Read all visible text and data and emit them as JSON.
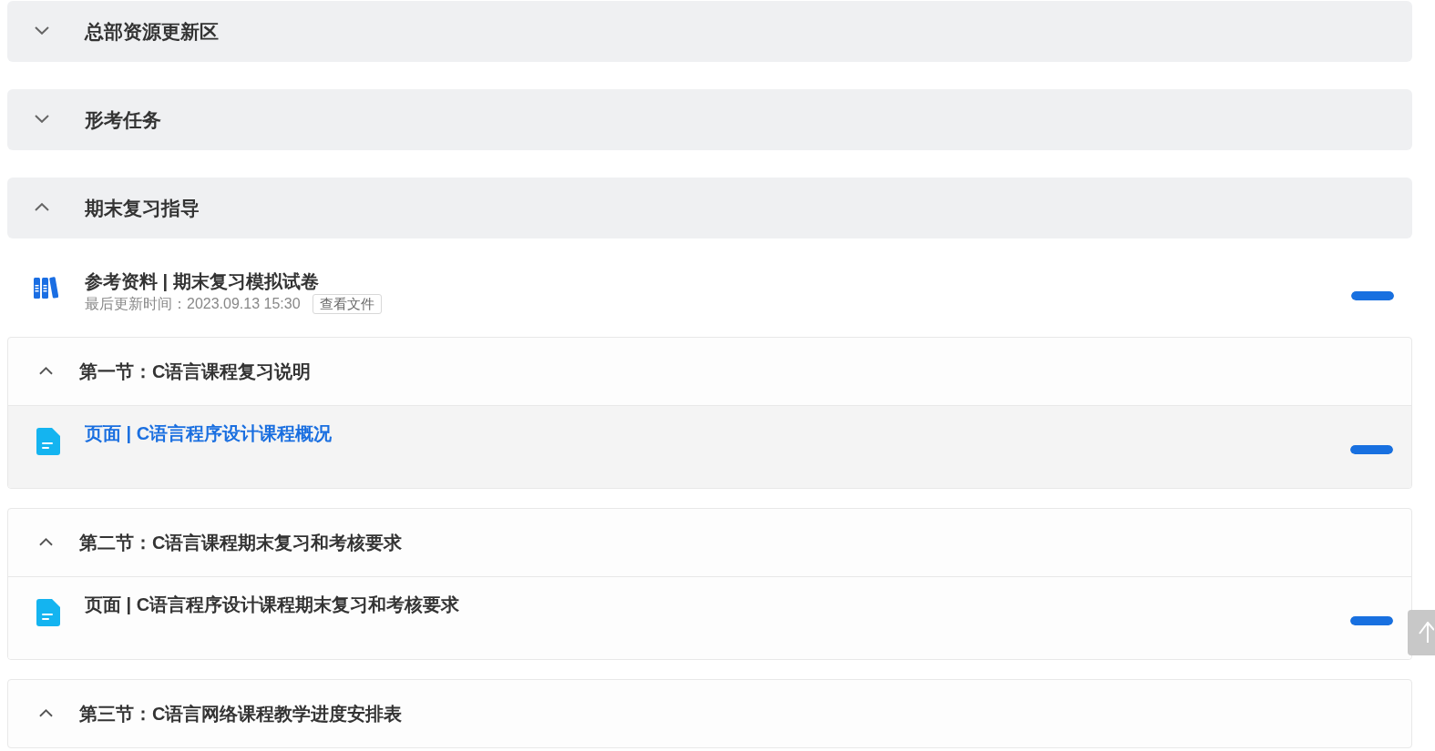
{
  "chapters": [
    {
      "title": "总部资源更新区",
      "expanded": false
    },
    {
      "title": "形考任务",
      "expanded": false
    },
    {
      "title": "期末复习指导",
      "expanded": true,
      "resources": [
        {
          "kind": "reference",
          "title": "参考资料 | 期末复习模拟试卷",
          "updated": "最后更新时间：2023.09.13 15:30",
          "action": "查看文件",
          "level": 1
        }
      ],
      "sections": [
        {
          "title": "第一节：C语言课程复习说明",
          "expanded": true,
          "items": [
            {
              "kind": "page",
              "title": "页面 | C语言程序设计课程概况",
              "selected": true,
              "level": 1
            }
          ]
        },
        {
          "title": "第二节：C语言课程期末复习和考核要求",
          "expanded": true,
          "items": [
            {
              "kind": "page",
              "title": "页面 | C语言程序设计课程期末复习和考核要求",
              "selected": false,
              "level": 1
            }
          ]
        },
        {
          "title": "第三节：C语言网络课程教学进度安排表",
          "expanded": true
        }
      ]
    }
  ]
}
